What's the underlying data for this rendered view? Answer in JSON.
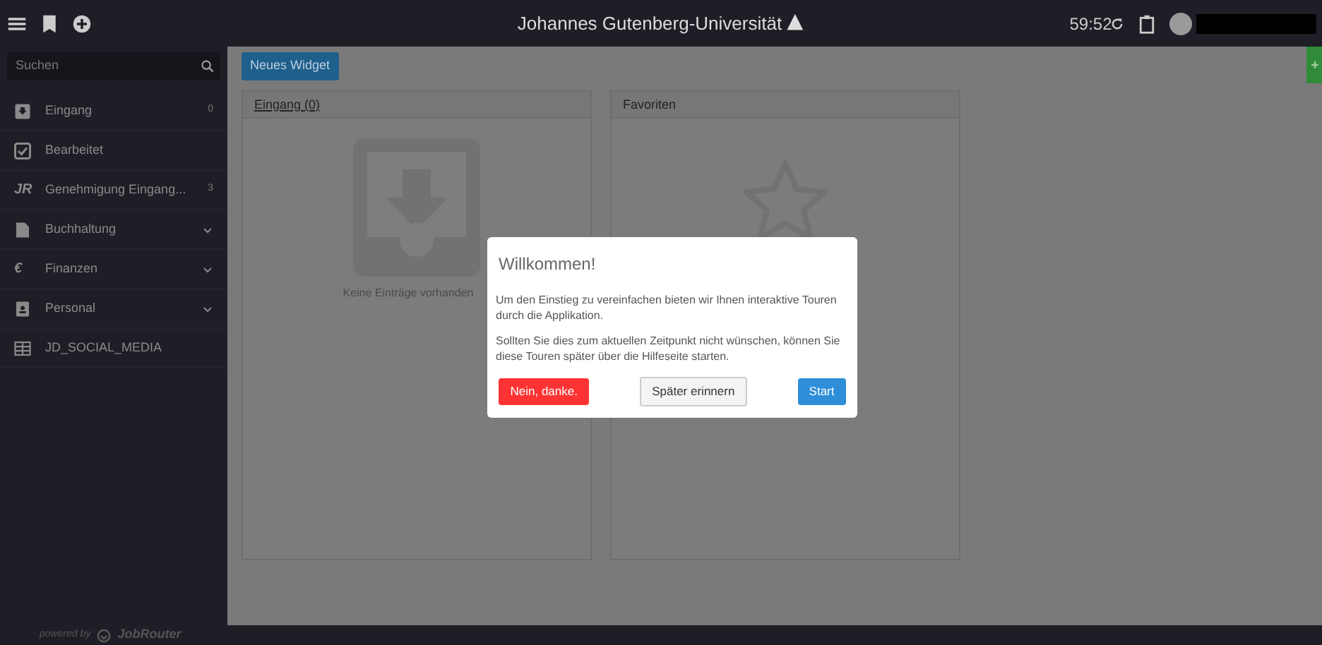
{
  "topbar": {
    "title": "Johannes Gutenberg-Universität",
    "timer": "59:52"
  },
  "sidebar": {
    "search": {
      "placeholder": "Suchen"
    },
    "items": [
      {
        "kind": "inbox",
        "label": "Eingang",
        "count": "0"
      },
      {
        "kind": "check",
        "label": "Bearbeitet"
      },
      {
        "kind": "text",
        "icon_text": "JR",
        "label": "Genehmigung Eingang...",
        "count": "3"
      },
      {
        "kind": "document",
        "label": "Buchhaltung",
        "expanded": false
      },
      {
        "kind": "text",
        "icon_text": "€",
        "label": "Finanzen",
        "expanded": false
      },
      {
        "kind": "badge",
        "label": "Personal",
        "expanded": false
      },
      {
        "kind": "table",
        "label": "JD_SOCIAL_MEDIA"
      }
    ],
    "footer": {
      "prefix": "powered by",
      "brand": "JobRouter"
    }
  },
  "toolbar": {
    "button": "Neues Widget"
  },
  "widgets": [
    {
      "kind": "inbox",
      "title": "Eingang (0)",
      "empty_text": "Keine Einträge vorhanden"
    },
    {
      "kind": "favorites",
      "title": "Favoriten"
    }
  ],
  "dialog": {
    "title": "Willkommen!",
    "paragraphs": [
      "Um den Einstieg zu vereinfachen bieten wir Ihnen interaktive Touren durch die Applikation.",
      "Sollten Sie dies zum aktuellen Zeitpunkt nicht wünschen, können Sie diese Touren später über die Hilfeseite starten."
    ],
    "buttons": [
      {
        "kind": "danger",
        "label": "Nein, danke."
      },
      {
        "kind": "secondary",
        "label": "Später erinnern"
      },
      {
        "kind": "primary",
        "label": "Start"
      }
    ]
  }
}
